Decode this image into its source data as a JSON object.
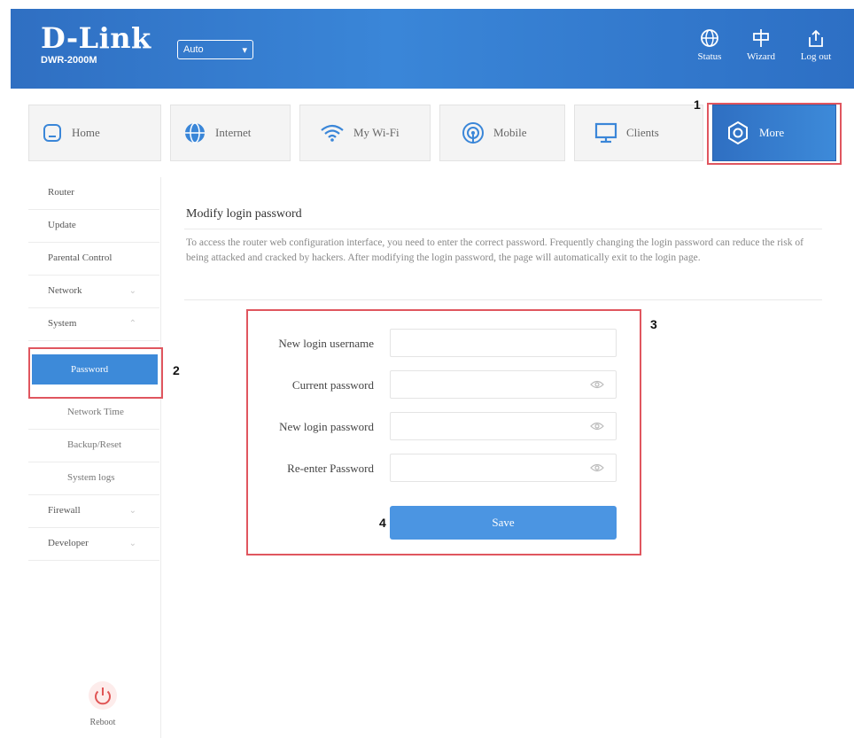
{
  "header": {
    "logo": "D-Link",
    "model": "DWR-2000M",
    "language": "Auto",
    "actions": [
      {
        "label": "Status",
        "icon": "globe-icon"
      },
      {
        "label": "Wizard",
        "icon": "wizard-icon"
      },
      {
        "label": "Log out",
        "icon": "logout-icon"
      }
    ]
  },
  "nav": {
    "tabs": [
      {
        "label": "Home",
        "icon": "home-icon"
      },
      {
        "label": "Internet",
        "icon": "globe-icon"
      },
      {
        "label": "My Wi-Fi",
        "icon": "wifi-icon"
      },
      {
        "label": "Mobile",
        "icon": "mobile-signal-icon"
      },
      {
        "label": "Clients",
        "icon": "monitor-icon"
      },
      {
        "label": "More",
        "icon": "settings-icon"
      }
    ],
    "active": "More"
  },
  "sidebar": {
    "items": [
      {
        "label": "Router",
        "sub": false,
        "chevron": false
      },
      {
        "label": "Update",
        "sub": false,
        "chevron": false
      },
      {
        "label": "Parental Control",
        "sub": false,
        "chevron": false
      },
      {
        "label": "Network",
        "sub": false,
        "chevron": true
      },
      {
        "label": "System",
        "sub": false,
        "chevron": true
      },
      {
        "label": "Password",
        "sub": true,
        "chevron": false,
        "active": true
      },
      {
        "label": "Network Time",
        "sub": true,
        "chevron": false
      },
      {
        "label": "Backup/Reset",
        "sub": true,
        "chevron": false
      },
      {
        "label": "System logs",
        "sub": true,
        "chevron": false
      },
      {
        "label": "Firewall",
        "sub": false,
        "chevron": true
      },
      {
        "label": "Developer",
        "sub": false,
        "chevron": true
      }
    ],
    "reboot_label": "Reboot"
  },
  "main": {
    "title": "Modify login password",
    "description": "To access the router web configuration interface, you need to enter the correct password. Frequently changing the login password can reduce the risk of being attacked and cracked by hackers. After modifying the login password, the page will automatically exit to the login page.",
    "fields": [
      {
        "label": "New login username",
        "value": "",
        "eye": false
      },
      {
        "label": "Current password",
        "value": "",
        "eye": true
      },
      {
        "label": "New login password",
        "value": "",
        "eye": true
      },
      {
        "label": "Re-enter Password",
        "value": "",
        "eye": true
      }
    ],
    "save_label": "Save"
  },
  "annotations": {
    "markers": [
      "1",
      "2",
      "3",
      "4"
    ],
    "highlight_color": "#e0565f"
  },
  "colors": {
    "brand_blue": "#3a86d8",
    "button_blue": "#4b95e2"
  }
}
